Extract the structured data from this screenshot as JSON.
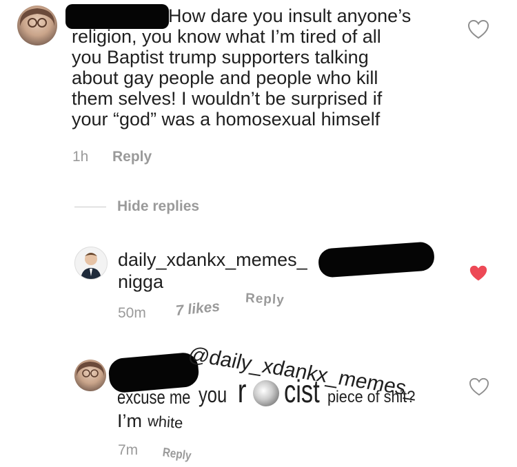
{
  "comment1": {
    "text": "How dare you insult anyone’s religion, you know what I’m tired of all you Baptist trump supporters talking about gay people and people who kill them selves! I wouldn’t be surprised if your “god” was a homosexual himself",
    "line1": "How dare you insult anyone’s",
    "line2": "religion, you know what I’m tired of all",
    "line3": "you Baptist trump supporters talking",
    "line4": "about gay people and people who kill",
    "line5": "them selves! I wouldn’t be surprised if",
    "line6": "your “god” was a homosexual himself",
    "time": "1h",
    "reply": "Reply",
    "liked": false
  },
  "hide_replies": "Hide replies",
  "reply1": {
    "username": "daily_xdankx_memes_",
    "text": "nigga",
    "time": "50m",
    "likes": "7 likes",
    "reply": "Reply",
    "liked": true,
    "heart_color": "#ed4956"
  },
  "reply2": {
    "mention": "@daily_xdankx_memes_",
    "w1": "excuse me",
    "w2": "you",
    "w3": "r",
    "w4": "cist",
    "w5": "piece of shit?",
    "line2a": "I’m",
    "line2b": "white",
    "time": "7m",
    "reply": "Reply",
    "liked": false
  }
}
